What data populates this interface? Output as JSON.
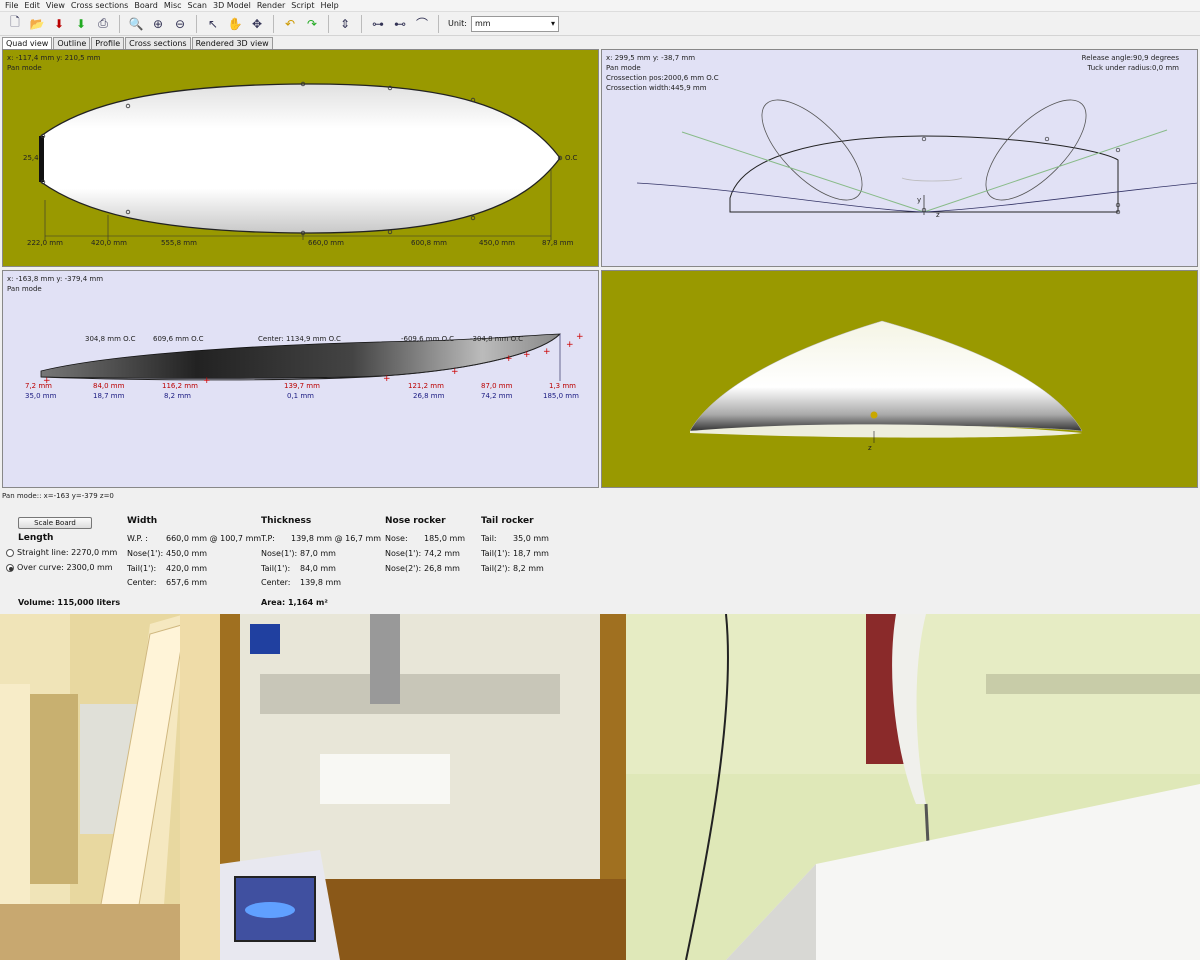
{
  "menu": [
    "File",
    "Edit",
    "View",
    "Cross sections",
    "Board",
    "Misc",
    "Scan",
    "3D Model",
    "Render",
    "Script",
    "Help"
  ],
  "toolbar": {
    "unit_label": "Unit:",
    "unit_value": "mm"
  },
  "tabs": [
    "Quad view",
    "Outline",
    "Profile",
    "Cross sections",
    "Rendered 3D view"
  ],
  "outline": {
    "coords": "x: -117,4 mm    y: 210,5 mm",
    "mode": "Pan mode",
    "left_dim": "25,4",
    "right_dim": "O.C",
    "bottom_dims": [
      "222,0 mm",
      "420,0 mm",
      "555,8 mm",
      "660,0 mm",
      "600,8 mm",
      "450,0 mm",
      "87,8 mm"
    ]
  },
  "cross": {
    "coords": "x: 299,5 mm    y: -38,7 mm",
    "mode": "Pan mode",
    "pos": "Crossection pos:2000,6 mm O.C",
    "width": "Crossection width:445,9 mm",
    "release": "Release angle:90,9 degrees",
    "tuck": "Tuck under radius:0,0 mm",
    "axis_z": "z",
    "axis_y": "y"
  },
  "profile": {
    "coords": "x: -163,8 mm    y: -379,4 mm",
    "mode": "Pan mode",
    "top_labels": [
      "304,8 mm O.C",
      "609,6 mm O.C",
      "Center: 1134,9 mm O.C",
      "-609,6 mm O.C",
      "-304,8 mm O.C"
    ],
    "red_labels": [
      "7,2 mm",
      "84,0 mm",
      "116,2 mm",
      "139,7 mm",
      "121,2 mm",
      "87,0 mm",
      "1,3 mm"
    ],
    "blue_labels": [
      "35,0 mm",
      "18,7 mm",
      "8,2 mm",
      "0,1 mm",
      "26,8 mm",
      "74,2 mm",
      "185,0 mm"
    ]
  },
  "render3d": {
    "axis": "z"
  },
  "status": "Pan mode:: x=-163 y=-379 z=0",
  "info": {
    "scale_button": "Scale Board",
    "length_title": "Length",
    "straight": "Straight line: 2270,0 mm",
    "curve": "Over curve: 2300,0 mm",
    "volume": "Volume: 115,000 liters",
    "width_title": "Width",
    "width_rows": [
      [
        "W.P. :",
        "660,0 mm @ 100,7 mm"
      ],
      [
        "Nose(1'):",
        "450,0 mm"
      ],
      [
        "Tail(1'):",
        "420,0 mm"
      ],
      [
        "Center:",
        "657,6 mm"
      ]
    ],
    "thick_title": "Thickness",
    "thick_rows": [
      [
        "T.P:",
        "139,8 mm @ 16,7 mm"
      ],
      [
        "Nose(1'):",
        "87,0 mm"
      ],
      [
        "Tail(1'):",
        "84,0 mm"
      ],
      [
        "Center:",
        "139,8 mm"
      ]
    ],
    "area": "Area: 1,164 m²",
    "nose_title": "Nose rocker",
    "nose_rows": [
      [
        "Nose:",
        "185,0 mm"
      ],
      [
        "Nose(1'):",
        "74,2 mm"
      ],
      [
        "Nose(2'):",
        "26,8 mm"
      ]
    ],
    "tail_title": "Tail rocker",
    "tail_rows": [
      [
        "Tail:",
        "35,0 mm"
      ],
      [
        "Tail(1'):",
        "18,7 mm"
      ],
      [
        "Tail(2'):",
        "8,2 mm"
      ]
    ]
  },
  "colors": {
    "olive": "#999900",
    "lavender": "#e1e1f5"
  }
}
